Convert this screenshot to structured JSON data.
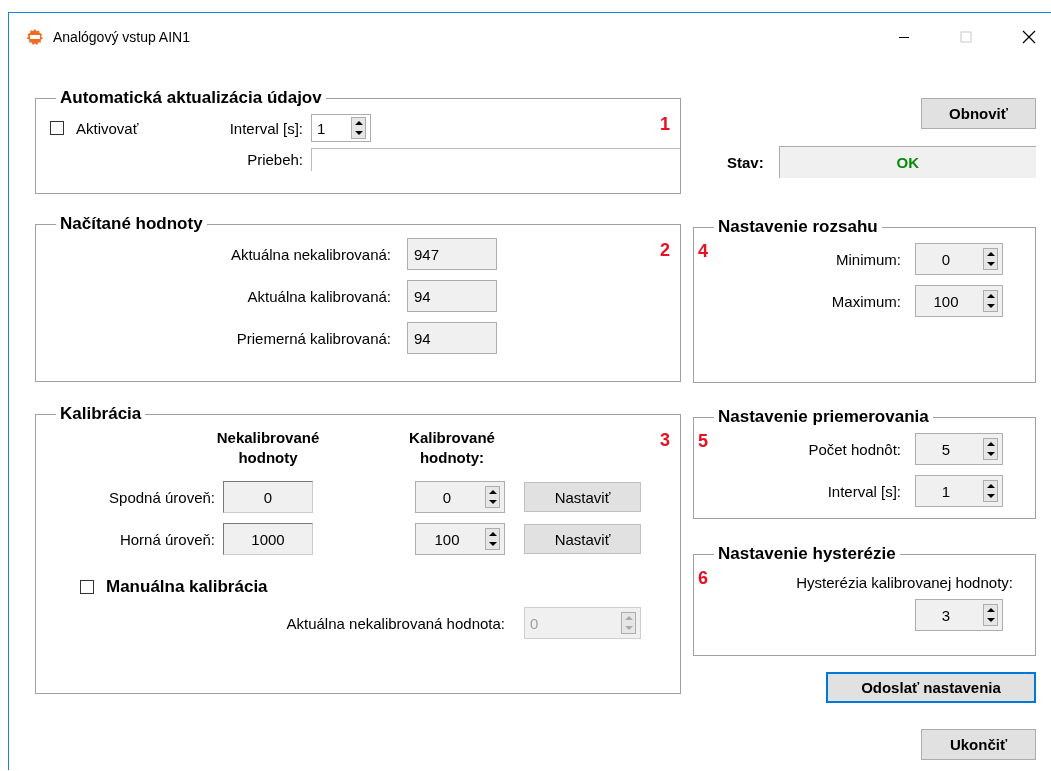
{
  "window": {
    "title": "Analógový vstup AIN1",
    "controls": [
      {
        "kind": "minimize",
        "disabled": false
      },
      {
        "kind": "maximize",
        "disabled": true
      },
      {
        "kind": "close",
        "disabled": false
      }
    ]
  },
  "auto_update": {
    "title": "Automatická aktualizácia údajov",
    "number": "1",
    "activate": {
      "label": "Aktivovať",
      "checked": false
    },
    "interval": {
      "label": "Interval [s]:",
      "value": "1"
    },
    "progress": {
      "label": "Priebeh:"
    }
  },
  "readings": {
    "title": "Načítané hodnoty",
    "number": "2",
    "rows": [
      {
        "label": "Aktuálna nekalibrovaná:",
        "value": "947"
      },
      {
        "label": "Aktuálna kalibrovaná:",
        "value": "94"
      },
      {
        "label": "Priemerná kalibrovaná:",
        "value": "94"
      }
    ]
  },
  "calibration": {
    "title": "Kalibrácia",
    "number": "3",
    "column_headers": [
      "Nekalibrované hodnoty",
      "Kalibrované hodnoty:"
    ],
    "rows": [
      {
        "label": "Spodná úroveň:",
        "raw": "0",
        "calibrated": "0",
        "button": "Nastaviť"
      },
      {
        "label": "Horná úroveň:",
        "raw": "1000",
        "calibrated": "100",
        "button": "Nastaviť"
      }
    ],
    "manual": {
      "label": "Manuálna kalibrácia",
      "checked": false
    },
    "manual_value": {
      "label": "Aktuálna nekalibrovaná hodnota:",
      "value": "0",
      "disabled": true
    }
  },
  "refresh_button": "Obnoviť",
  "status": {
    "label": "Stav:",
    "value": "OK"
  },
  "range": {
    "title": "Nastavenie rozsahu",
    "number": "4",
    "rows": [
      {
        "label": "Minimum:",
        "value": "0"
      },
      {
        "label": "Maximum:",
        "value": "100"
      }
    ]
  },
  "averaging": {
    "title": "Nastavenie priemerovania",
    "number": "5",
    "rows": [
      {
        "label": "Počet hodnôt:",
        "value": "5"
      },
      {
        "label": "Interval [s]:",
        "value": "1"
      }
    ]
  },
  "hysteresis": {
    "title": "Nastavenie hysterézie",
    "number": "6",
    "label": "Hysterézia kalibrovanej hodnoty:",
    "value": "3"
  },
  "send_button": "Odoslať nastavenia",
  "exit_button": "Ukončiť"
}
